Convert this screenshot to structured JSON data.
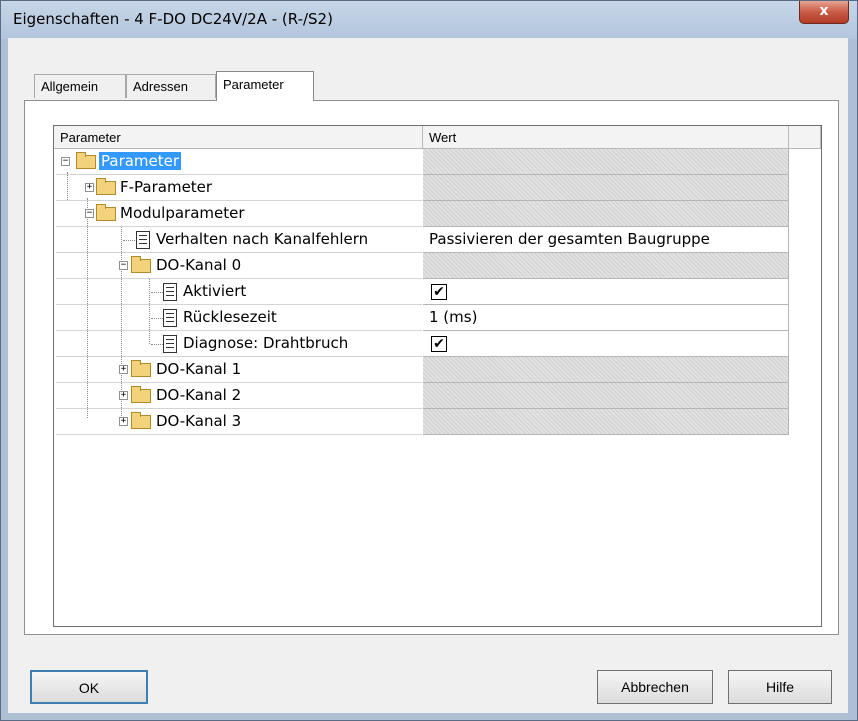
{
  "window": {
    "title": "Eigenschaften - 4 F-DO DC24V/2A - (R-/S2)",
    "close_label": "x"
  },
  "tabs": [
    {
      "label": "Allgemein"
    },
    {
      "label": "Adressen"
    },
    {
      "label": "Parameter"
    }
  ],
  "table": {
    "headers": [
      "Parameter",
      "Wert"
    ],
    "rows": [
      {
        "label": "Parameter",
        "value": ""
      },
      {
        "label": "F-Parameter",
        "value": ""
      },
      {
        "label": "Modulparameter",
        "value": ""
      },
      {
        "label": "Verhalten nach Kanalfehlern",
        "value": "Passivieren der gesamten Baugruppe"
      },
      {
        "label": "DO-Kanal 0",
        "value": ""
      },
      {
        "label": "Aktiviert",
        "value": "✔"
      },
      {
        "label": "Rücklesezeit",
        "value": "1 (ms)"
      },
      {
        "label": "Diagnose: Drahtbruch",
        "value": "✔"
      },
      {
        "label": "DO-Kanal 1",
        "value": ""
      },
      {
        "label": "DO-Kanal 2",
        "value": ""
      },
      {
        "label": "DO-Kanal 3",
        "value": ""
      }
    ],
    "expand_minus": "−",
    "expand_plus": "+"
  },
  "buttons": {
    "ok": "OK",
    "cancel": "Abbrechen",
    "help": "Hilfe"
  }
}
